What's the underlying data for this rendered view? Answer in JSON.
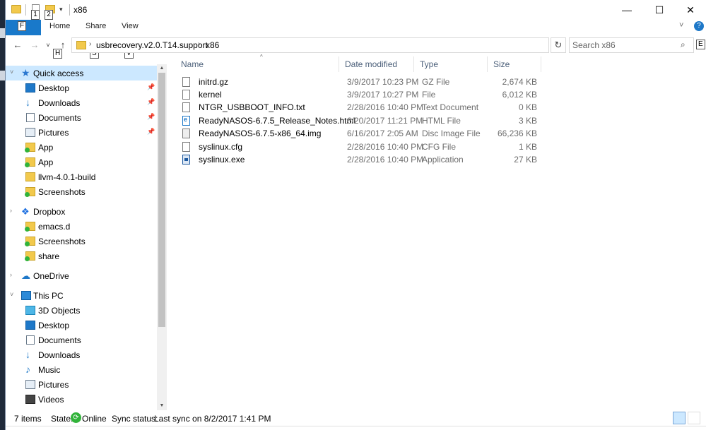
{
  "window": {
    "title": "x86",
    "keytips": {
      "qa1": "1",
      "qa2": "2",
      "file": "F",
      "home": "H",
      "share": "S",
      "view": "V",
      "help": "E"
    },
    "controls": {
      "minimize": "—",
      "maximize": "☐",
      "close": "✕"
    }
  },
  "ribbon": {
    "tabs": {
      "file": "",
      "home": "Home",
      "share": "Share",
      "view": "View"
    },
    "collapse_icon": "˅",
    "help_icon": "?"
  },
  "address": {
    "breadcrumbs": [
      "usbrecovery.v2.0.T14.support",
      "x86"
    ],
    "search_placeholder": "Search x86"
  },
  "nav": {
    "quick_access": "Quick access",
    "quick_items": [
      "Desktop",
      "Downloads",
      "Documents",
      "Pictures",
      "App",
      "App",
      "llvm-4.0.1-build",
      "Screenshots"
    ],
    "dropbox": "Dropbox",
    "dropbox_items": [
      "emacs.d",
      "Screenshots",
      "share"
    ],
    "onedrive": "OneDrive",
    "this_pc": "This PC",
    "pc_items": [
      "3D Objects",
      "Desktop",
      "Documents",
      "Downloads",
      "Music",
      "Pictures",
      "Videos"
    ]
  },
  "columns": {
    "name": "Name",
    "date": "Date modified",
    "type": "Type",
    "size": "Size"
  },
  "files": [
    {
      "name": "initrd.gz",
      "date": "3/9/2017 10:23 PM",
      "type": "GZ File",
      "size": "2,674 KB",
      "icon": "file-icon"
    },
    {
      "name": "kernel",
      "date": "3/9/2017 10:27 PM",
      "type": "File",
      "size": "6,012 KB",
      "icon": "file-icon"
    },
    {
      "name": "NTGR_USBBOOT_INFO.txt",
      "date": "2/28/2016 10:40 PM",
      "type": "Text Document",
      "size": "0 KB",
      "icon": "text-file-icon"
    },
    {
      "name": "ReadyNASOS-6.7.5_Release_Notes.html",
      "date": "6/20/2017 11:21 PM",
      "type": "HTML File",
      "size": "3 KB",
      "icon": "html-file-icon"
    },
    {
      "name": "ReadyNASOS-6.7.5-x86_64.img",
      "date": "6/16/2017 2:05 AM",
      "type": "Disc Image File",
      "size": "66,236 KB",
      "icon": "disc-image-icon"
    },
    {
      "name": "syslinux.cfg",
      "date": "2/28/2016 10:40 PM",
      "type": "CFG File",
      "size": "1 KB",
      "icon": "file-icon"
    },
    {
      "name": "syslinux.exe",
      "date": "2/28/2016 10:40 PM",
      "type": "Application",
      "size": "27 KB",
      "icon": "exe-icon"
    }
  ],
  "status": {
    "count": "7 items",
    "state_label": "State:",
    "state_value": "Online",
    "sync_label": "Sync status:",
    "sync_value": "Last sync on 8/2/2017 1:41 PM"
  }
}
